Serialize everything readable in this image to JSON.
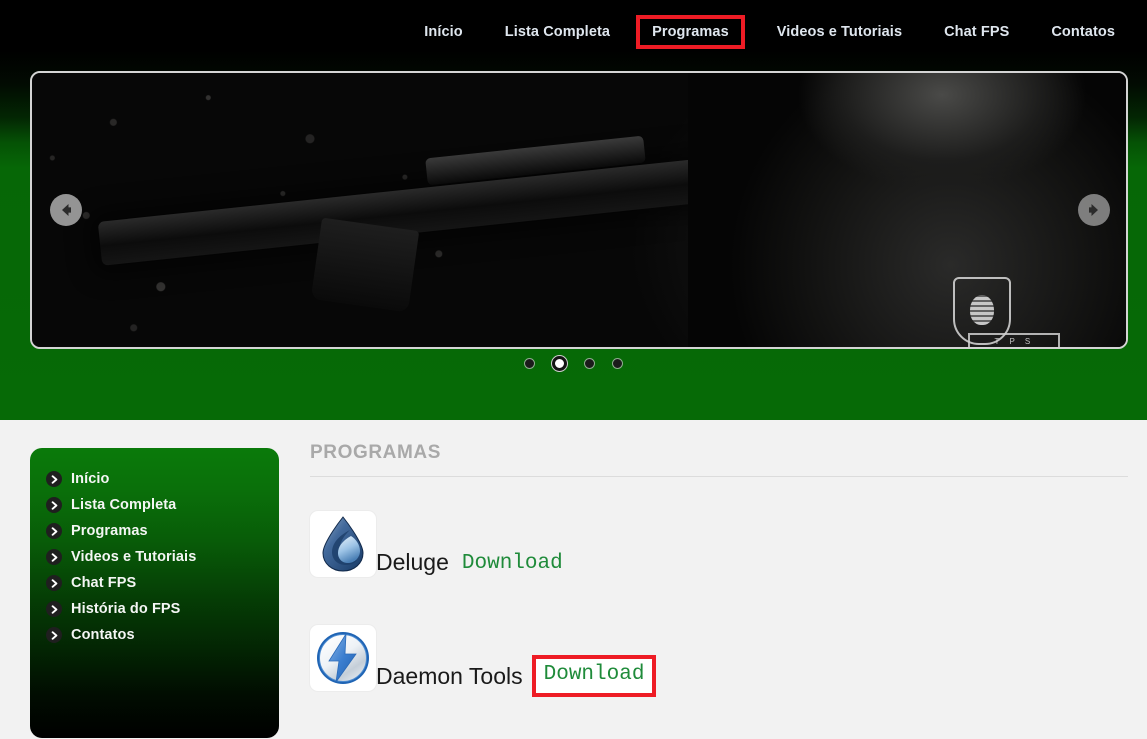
{
  "topnav": {
    "items": [
      {
        "label": "Início",
        "marked": false
      },
      {
        "label": "Lista Completa",
        "marked": false
      },
      {
        "label": "Programas",
        "marked": true
      },
      {
        "label": "Videos e Tutoriais",
        "marked": false
      },
      {
        "label": "Chat FPS",
        "marked": false
      },
      {
        "label": "Contatos",
        "marked": false
      }
    ]
  },
  "carousel": {
    "prev_icon": "arrow-left-icon",
    "next_icon": "arrow-right-icon",
    "slide_alt": "Soldier aiming assault rifle against concrete wall",
    "patch_text": "T P S",
    "dots": [
      {
        "active": false
      },
      {
        "active": true
      },
      {
        "active": false
      },
      {
        "active": false
      }
    ]
  },
  "sidebar": {
    "items": [
      {
        "label": "Início"
      },
      {
        "label": "Lista Completa"
      },
      {
        "label": "Programas"
      },
      {
        "label": "Videos e Tutoriais"
      },
      {
        "label": "Chat FPS"
      },
      {
        "label": "História do FPS"
      },
      {
        "label": "Contatos"
      }
    ]
  },
  "main": {
    "section_title": "PROGRAMAS",
    "programs": [
      {
        "name": "Deluge",
        "download_label": "Download",
        "icon": "deluge-drop-icon",
        "marked": false
      },
      {
        "name": "Daemon Tools",
        "download_label": "Download",
        "icon": "daemon-tools-bolt-icon",
        "marked": true
      }
    ]
  },
  "colors": {
    "green_band": "#066a06",
    "sidebar_top_green": "#0a7a0a",
    "highlight_red": "#ee1c25",
    "download_green": "#1f8b3a",
    "content_bg": "#f2f2f2",
    "nav_text": "#dfe6ee",
    "section_title_gray": "#a9a9a9"
  }
}
